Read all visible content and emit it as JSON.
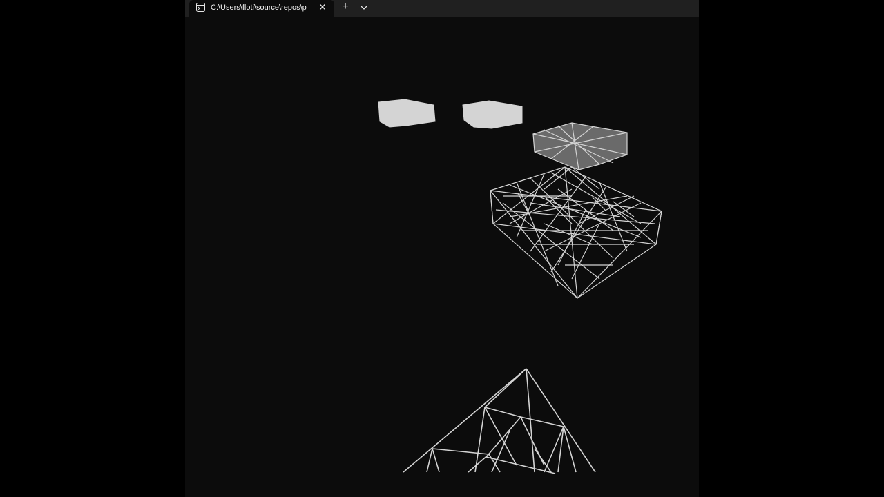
{
  "tab": {
    "title": "C:\\Users\\floti\\source\\repos\\p",
    "icon": "terminal-icon"
  },
  "toolbar": {
    "close_label": "✕",
    "new_tab_label": "+",
    "dropdown_icon": "chevron-down-icon"
  },
  "colors": {
    "wire": "#d4d4d4",
    "background": "#0c0c0c",
    "tabbar": "#202020"
  }
}
